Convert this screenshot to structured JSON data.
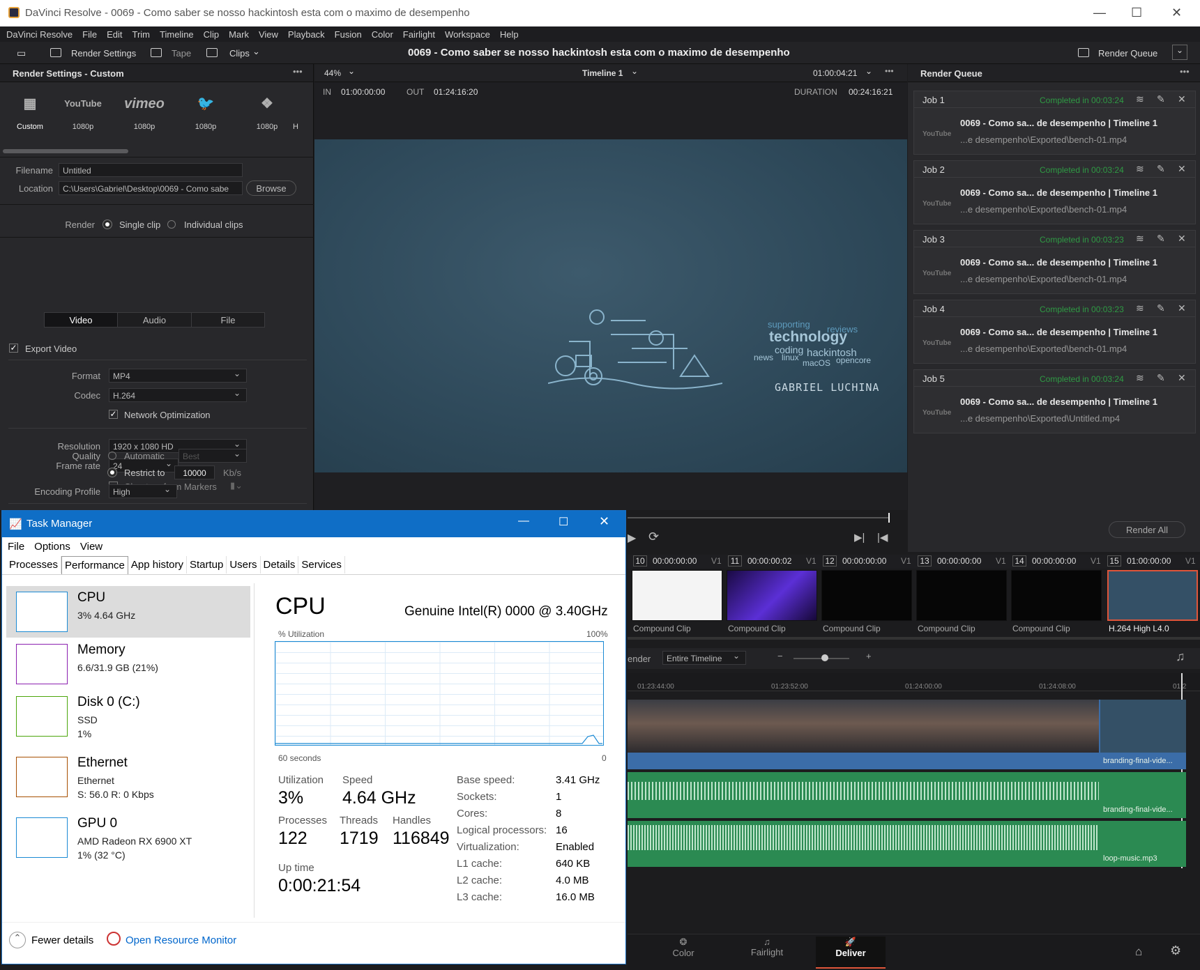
{
  "window": {
    "title": "DaVinci Resolve - 0069 - Como saber se nosso hackintosh esta com o maximo de desempenho"
  },
  "menu": [
    "DaVinci Resolve",
    "File",
    "Edit",
    "Trim",
    "Timeline",
    "Clip",
    "Mark",
    "View",
    "Playback",
    "Fusion",
    "Color",
    "Fairlight",
    "Workspace",
    "Help"
  ],
  "toolbar": {
    "render_settings": "Render Settings",
    "tape": "Tape",
    "clips": "Clips",
    "project_title": "0069 - Como saber se nosso hackintosh esta com o maximo de desempenho",
    "render_queue": "Render Queue"
  },
  "render_settings": {
    "title": "Render Settings - Custom",
    "presets": [
      {
        "icon": "film-icon",
        "name": "Custom"
      },
      {
        "icon": "youtube-icon",
        "brand": "YouTube",
        "name": "1080p"
      },
      {
        "icon": "vimeo-icon",
        "brand": "vimeo",
        "name": "1080p"
      },
      {
        "icon": "twitter-icon",
        "name": "1080p"
      },
      {
        "icon": "dropbox-icon",
        "name": "1080p"
      },
      {
        "name": "H"
      }
    ],
    "filename_label": "Filename",
    "filename": "Untitled",
    "location_label": "Location",
    "location": "C:\\Users\\Gabriel\\Desktop\\0069 - Como sabe",
    "browse": "Browse",
    "render_label": "Render",
    "single_clip": "Single clip",
    "individual_clips": "Individual clips",
    "tabs": [
      "Video",
      "Audio",
      "File"
    ],
    "export_video": "Export Video",
    "format_label": "Format",
    "format": "MP4",
    "codec_label": "Codec",
    "codec": "H.264",
    "network_opt": "Network Optimization",
    "resolution_label": "Resolution",
    "resolution": "1920 x 1080 HD",
    "framerate_label": "Frame rate",
    "framerate": "24",
    "chapters": "Chapters from Markers",
    "quality_label": "Quality",
    "automatic": "Automatic",
    "best": "Best",
    "restrict": "Restrict to",
    "bitrate": "10000",
    "kbs": "Kb/s",
    "profile_label": "Encoding Profile",
    "profile": "High"
  },
  "viewer": {
    "zoom": "44%",
    "timeline": "Timeline 1",
    "timecode": "01:00:04:21",
    "in_label": "IN",
    "in": "01:00:00:00",
    "out_label": "OUT",
    "out": "01:24:16:20",
    "duration_label": "DURATION",
    "duration": "00:24:16:21",
    "frame_words": [
      "supporting",
      "reviews",
      "technology",
      "coding",
      "hackintosh",
      "news",
      "linux",
      "macOS",
      "opencore"
    ],
    "frame_name": "GABRIEL LUCHINA"
  },
  "queue": {
    "title": "Render Queue",
    "render_all": "Render All",
    "jobs": [
      {
        "name": "Job 1",
        "status": "Completed in 00:03:24",
        "title": "0069 - Como sa... de desempenho | Timeline 1",
        "path": "...e desempenho\\Exported\\bench-01.mp4",
        "badge": "YouTube"
      },
      {
        "name": "Job 2",
        "status": "Completed in 00:03:24",
        "title": "0069 - Como sa... de desempenho | Timeline 1",
        "path": "...e desempenho\\Exported\\bench-01.mp4",
        "badge": "YouTube"
      },
      {
        "name": "Job 3",
        "status": "Completed in 00:03:23",
        "title": "0069 - Como sa... de desempenho | Timeline 1",
        "path": "...e desempenho\\Exported\\bench-01.mp4",
        "badge": "YouTube"
      },
      {
        "name": "Job 4",
        "status": "Completed in 00:03:23",
        "title": "0069 - Como sa... de desempenho | Timeline 1",
        "path": "...e desempenho\\Exported\\bench-01.mp4",
        "badge": "YouTube"
      },
      {
        "name": "Job 5",
        "status": "Completed in 00:03:24",
        "title": "0069 - Como sa... de desempenho | Timeline 1",
        "path": "...e desempenho\\Exported\\Untitled.mp4",
        "badge": "YouTube"
      }
    ]
  },
  "clips": [
    {
      "num": "10",
      "tc": "00:00:00:00",
      "track": "V1",
      "label": "Compound Clip"
    },
    {
      "num": "11",
      "tc": "00:00:00:02",
      "track": "V1",
      "label": "Compound Clip"
    },
    {
      "num": "12",
      "tc": "00:00:00:00",
      "track": "V1",
      "label": "Compound Clip"
    },
    {
      "num": "13",
      "tc": "00:00:00:00",
      "track": "V1",
      "label": "Compound Clip"
    },
    {
      "num": "14",
      "tc": "00:00:00:00",
      "track": "V1",
      "label": "Compound Clip"
    },
    {
      "num": "15",
      "tc": "01:00:00:00",
      "track": "V1",
      "label": "H.264 High L4.0"
    }
  ],
  "timeline": {
    "render_label": "ender",
    "render_mode": "Entire Timeline",
    "ruler": [
      "01:23:44:00",
      "01:23:52:00",
      "01:24:00:00",
      "01:24:08:00",
      "01:2"
    ],
    "v_clip": "branding-final-vide...",
    "a1_clip": "branding-final-vide...",
    "a2_clip": "loop-music.mp3"
  },
  "pages": {
    "color": "Color",
    "fairlight": "Fairlight",
    "deliver": "Deliver"
  },
  "taskmanager": {
    "title": "Task Manager",
    "menu": [
      "File",
      "Options",
      "View"
    ],
    "tabs": [
      "Processes",
      "Performance",
      "App history",
      "Startup",
      "Users",
      "Details",
      "Services"
    ],
    "sidebar": [
      {
        "name": "CPU",
        "l1": "3%  4.64 GHz",
        "l2": "",
        "color": "#1b8ad4"
      },
      {
        "name": "Memory",
        "l1": "6.6/31.9 GB (21%)",
        "l2": "",
        "color": "#8b1faf"
      },
      {
        "name": "Disk 0 (C:)",
        "l1": "SSD",
        "l2": "1%",
        "color": "#4ca60b"
      },
      {
        "name": "Ethernet",
        "l1": "Ethernet",
        "l2": "S: 56.0  R: 0 Kbps",
        "color": "#a74f01"
      },
      {
        "name": "GPU 0",
        "l1": "AMD Radeon RX 6900 XT",
        "l2": "1%  (32 °C)",
        "color": "#1b8ad4"
      }
    ],
    "cpu_title": "CPU",
    "cpu_model": "Genuine Intel(R) 0000 @ 3.40GHz",
    "util_label": "% Utilization",
    "util_max": "100%",
    "seconds": "60 seconds",
    "zero": "0",
    "stats": {
      "utilization_label": "Utilization",
      "utilization": "3%",
      "speed_label": "Speed",
      "speed": "4.64 GHz",
      "processes_label": "Processes",
      "processes": "122",
      "threads_label": "Threads",
      "threads": "1719",
      "handles_label": "Handles",
      "handles": "116849",
      "uptime_label": "Up time",
      "uptime": "0:00:21:54"
    },
    "specs": [
      [
        "Base speed:",
        "3.41 GHz"
      ],
      [
        "Sockets:",
        "1"
      ],
      [
        "Cores:",
        "8"
      ],
      [
        "Logical processors:",
        "16"
      ],
      [
        "Virtualization:",
        "Enabled"
      ],
      [
        "L1 cache:",
        "640 KB"
      ],
      [
        "L2 cache:",
        "4.0 MB"
      ],
      [
        "L3 cache:",
        "16.0 MB"
      ]
    ],
    "fewer": "Fewer details",
    "monitor": "Open Resource Monitor"
  }
}
